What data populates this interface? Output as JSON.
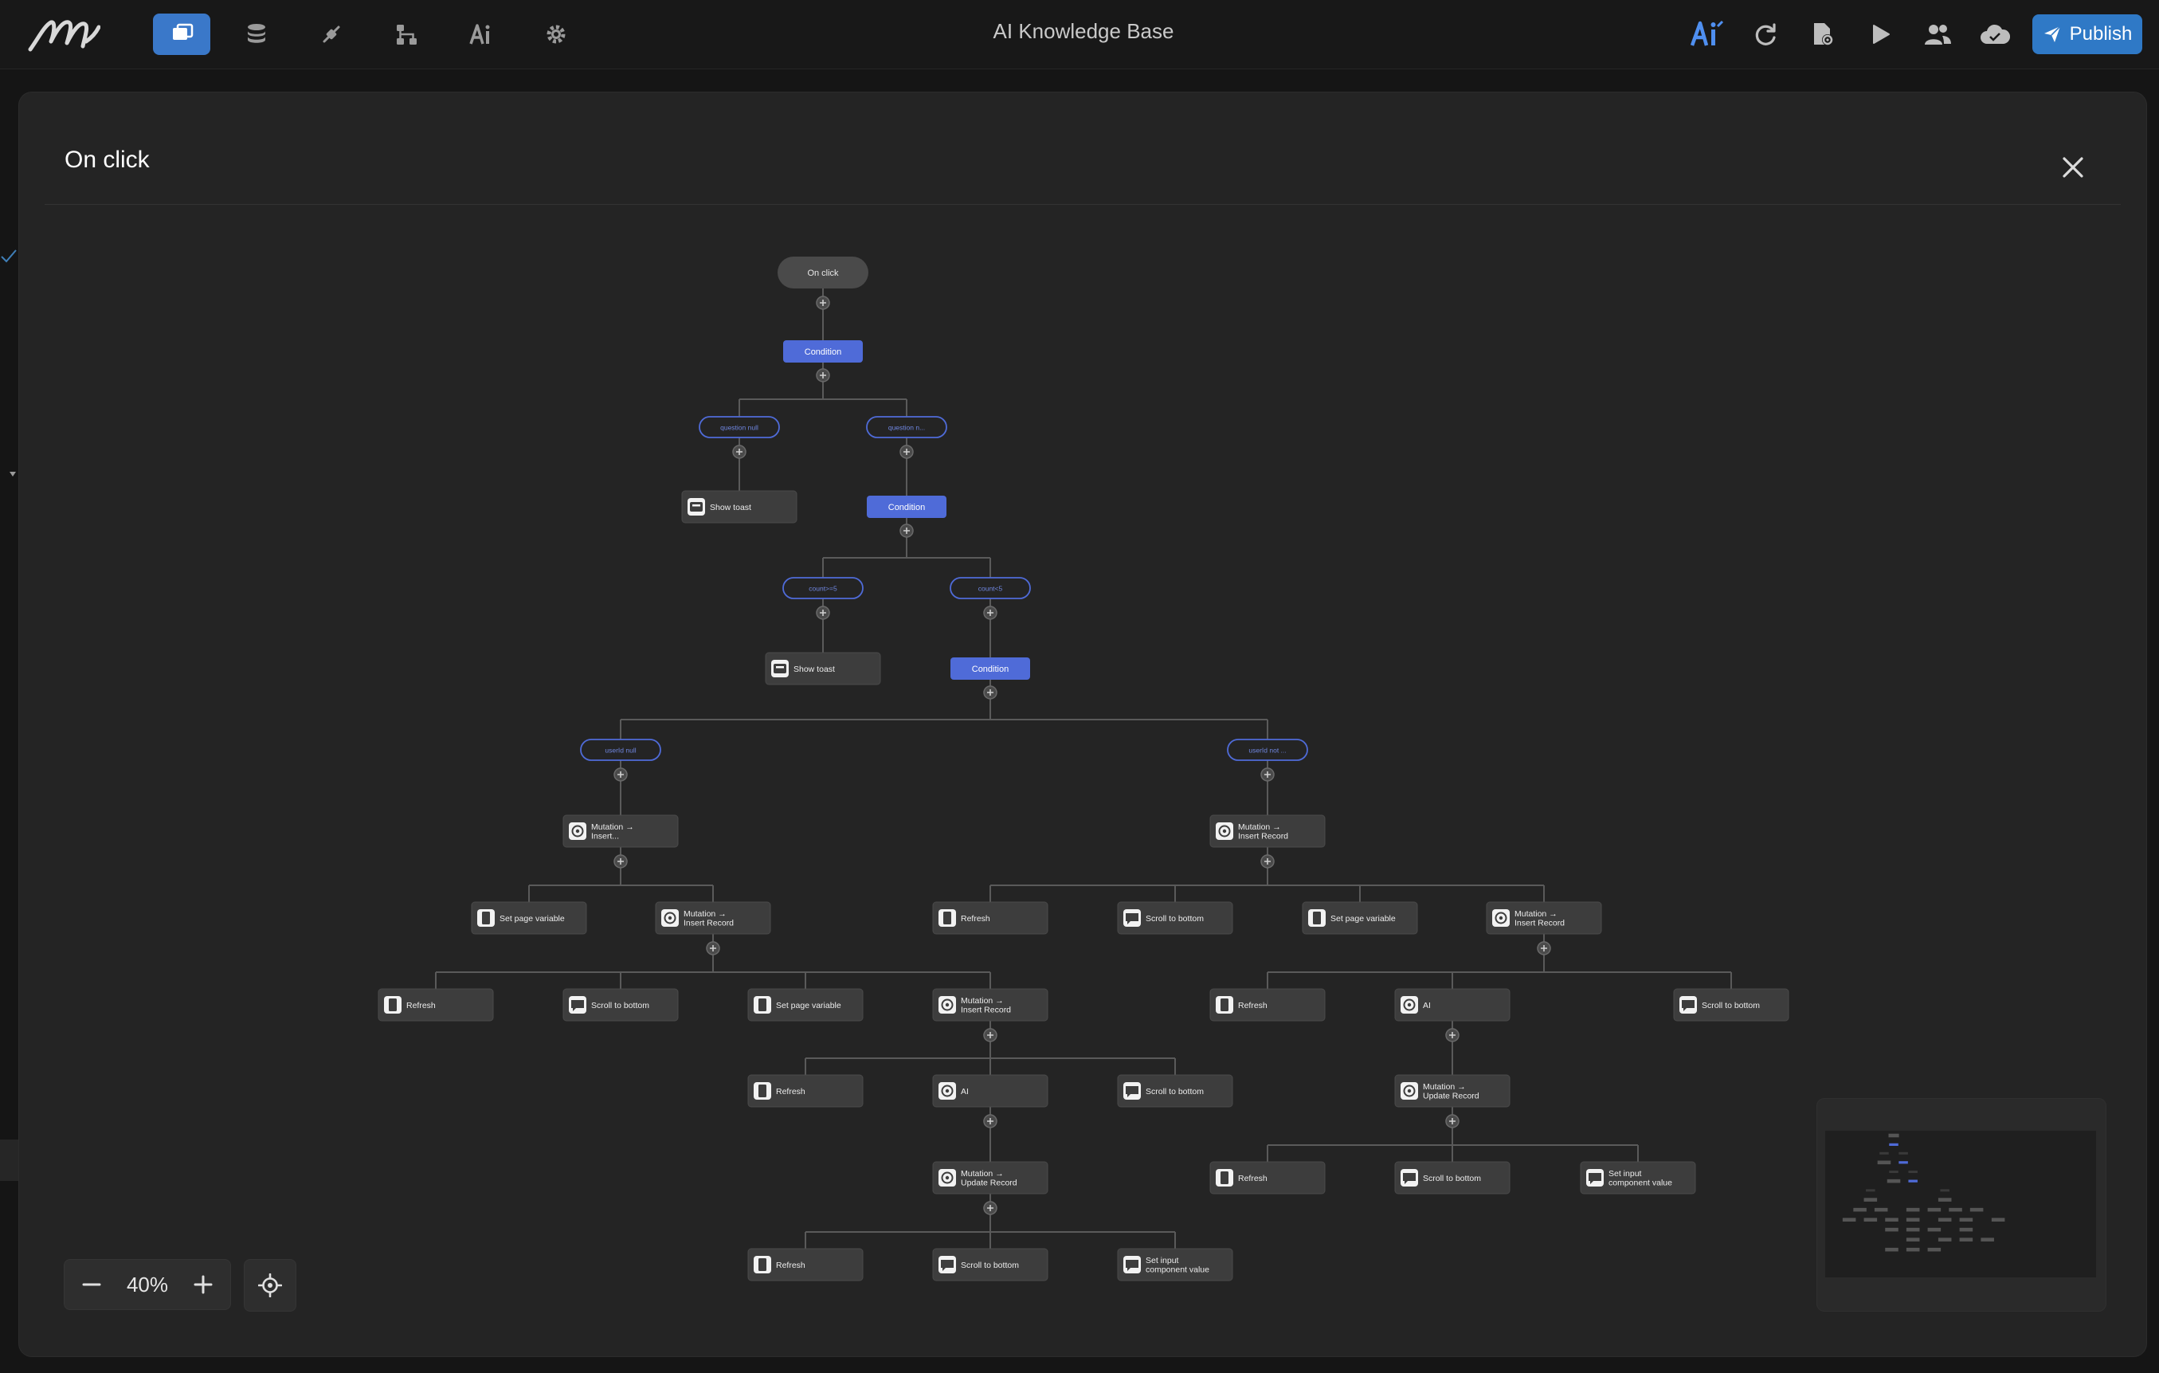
{
  "app": {
    "title": "AI Knowledge Base",
    "publish_label": "Publish"
  },
  "nav": {
    "items": [
      {
        "name": "pages-icon",
        "active": true
      },
      {
        "name": "database-icon",
        "active": false
      },
      {
        "name": "plugin-icon",
        "active": false
      },
      {
        "name": "workflow-icon",
        "active": false
      },
      {
        "name": "ai-icon",
        "active": false
      },
      {
        "name": "settings-icon",
        "active": false
      }
    ]
  },
  "toolbar": {
    "icons": [
      "ai-assistant-icon",
      "refresh-icon",
      "page-settings-icon",
      "preview-play-icon",
      "users-icon",
      "cloud-icon"
    ]
  },
  "modal": {
    "title": "On click"
  },
  "flow": {
    "nodes": [
      {
        "id": "root",
        "type": "start",
        "label": "On click"
      },
      {
        "id": "cond1",
        "type": "condition",
        "label": "Condition"
      },
      {
        "id": "br1a",
        "type": "branch",
        "label": "question null"
      },
      {
        "id": "br1b",
        "type": "branch",
        "label": "question n..."
      },
      {
        "id": "toast1",
        "type": "action",
        "label": "Show toast",
        "icon": "toast-icon"
      },
      {
        "id": "cond2",
        "type": "condition",
        "label": "Condition"
      },
      {
        "id": "br2a",
        "type": "branch",
        "label": "count>=5"
      },
      {
        "id": "br2b",
        "type": "branch",
        "label": "count<5"
      },
      {
        "id": "toast2",
        "type": "action",
        "label": "Show toast",
        "icon": "toast-icon"
      },
      {
        "id": "cond3",
        "type": "condition",
        "label": "Condition"
      },
      {
        "id": "br3a",
        "type": "branch",
        "label": "userId null"
      },
      {
        "id": "br3b",
        "type": "branch",
        "label": "userId not ..."
      },
      {
        "id": "mutL",
        "type": "action",
        "label": [
          "Mutation →",
          "Insert..."
        ],
        "icon": "mutation-icon"
      },
      {
        "id": "mutR",
        "type": "action",
        "label": [
          "Mutation →",
          "Insert Record"
        ],
        "icon": "mutation-icon"
      },
      {
        "id": "spvL1",
        "type": "action",
        "label": "Set page variable",
        "icon": "variable-icon"
      },
      {
        "id": "mutL2",
        "type": "action",
        "label": [
          "Mutation →",
          "Insert Record"
        ],
        "icon": "mutation-icon"
      },
      {
        "id": "refR1",
        "type": "action",
        "label": "Refresh",
        "icon": "refresh-action-icon"
      },
      {
        "id": "scrR1",
        "type": "action",
        "label": "Scroll to bottom",
        "icon": "scroll-icon"
      },
      {
        "id": "spvR1",
        "type": "action",
        "label": "Set page variable",
        "icon": "variable-icon"
      },
      {
        "id": "mutR2",
        "type": "action",
        "label": [
          "Mutation →",
          "Insert Record"
        ],
        "icon": "mutation-icon"
      },
      {
        "id": "refL3",
        "type": "action",
        "label": "Refresh",
        "icon": "refresh-action-icon"
      },
      {
        "id": "scrL3",
        "type": "action",
        "label": "Scroll to bottom",
        "icon": "scroll-icon"
      },
      {
        "id": "spvL3",
        "type": "action",
        "label": "Set page variable",
        "icon": "variable-icon"
      },
      {
        "id": "mutL3",
        "type": "action",
        "label": [
          "Mutation →",
          "Insert Record"
        ],
        "icon": "mutation-icon"
      },
      {
        "id": "refR3",
        "type": "action",
        "label": "Refresh",
        "icon": "refresh-action-icon"
      },
      {
        "id": "aiR3",
        "type": "action",
        "label": "AI",
        "icon": "mutation-icon"
      },
      {
        "id": "scrR3",
        "type": "action",
        "label": "Scroll to bottom",
        "icon": "scroll-icon"
      },
      {
        "id": "refL4",
        "type": "action",
        "label": "Refresh",
        "icon": "refresh-action-icon"
      },
      {
        "id": "aiL4",
        "type": "action",
        "label": "AI",
        "icon": "mutation-icon"
      },
      {
        "id": "scrL4",
        "type": "action",
        "label": "Scroll to bottom",
        "icon": "scroll-icon"
      },
      {
        "id": "updR4",
        "type": "action",
        "label": [
          "Mutation →",
          "Update Record"
        ],
        "icon": "mutation-icon"
      },
      {
        "id": "updL5",
        "type": "action",
        "label": [
          "Mutation →",
          "Update Record"
        ],
        "icon": "mutation-icon"
      },
      {
        "id": "refR5",
        "type": "action",
        "label": "Refresh",
        "icon": "refresh-action-icon"
      },
      {
        "id": "scrR5",
        "type": "action",
        "label": "Scroll to bottom",
        "icon": "scroll-icon"
      },
      {
        "id": "sicR5",
        "type": "action",
        "label": [
          "Set input",
          "component value"
        ],
        "icon": "scroll-icon"
      },
      {
        "id": "refL6",
        "type": "action",
        "label": "Refresh",
        "icon": "refresh-action-icon"
      },
      {
        "id": "scrL6",
        "type": "action",
        "label": "Scroll to bottom",
        "icon": "scroll-icon"
      },
      {
        "id": "sicL6",
        "type": "action",
        "label": [
          "Set input",
          "component value"
        ],
        "icon": "scroll-icon"
      }
    ],
    "edges": [
      [
        "root",
        "cond1"
      ],
      [
        "cond1",
        "br1a"
      ],
      [
        "cond1",
        "br1b"
      ],
      [
        "br1a",
        "toast1"
      ],
      [
        "br1b",
        "cond2"
      ],
      [
        "cond2",
        "br2a"
      ],
      [
        "cond2",
        "br2b"
      ],
      [
        "br2a",
        "toast2"
      ],
      [
        "br2b",
        "cond3"
      ],
      [
        "cond3",
        "br3a"
      ],
      [
        "cond3",
        "br3b"
      ],
      [
        "br3a",
        "mutL"
      ],
      [
        "br3b",
        "mutR"
      ],
      [
        "mutL",
        "spvL1"
      ],
      [
        "mutL",
        "mutL2"
      ],
      [
        "mutR",
        "refR1"
      ],
      [
        "mutR",
        "scrR1"
      ],
      [
        "mutR",
        "spvR1"
      ],
      [
        "mutR",
        "mutR2"
      ],
      [
        "mutL2",
        "refL3"
      ],
      [
        "mutL2",
        "scrL3"
      ],
      [
        "mutL2",
        "spvL3"
      ],
      [
        "mutL2",
        "mutL3"
      ],
      [
        "mutR2",
        "refR3"
      ],
      [
        "mutR2",
        "aiR3"
      ],
      [
        "mutR2",
        "scrR3"
      ],
      [
        "mutL3",
        "refL4"
      ],
      [
        "mutL3",
        "aiL4"
      ],
      [
        "mutL3",
        "scrL4"
      ],
      [
        "aiR3",
        "updR4"
      ],
      [
        "aiL4",
        "updL5"
      ],
      [
        "updR4",
        "refR5"
      ],
      [
        "updR4",
        "scrR5"
      ],
      [
        "updR4",
        "sicR5"
      ],
      [
        "updL5",
        "refL6"
      ],
      [
        "updL5",
        "scrL6"
      ],
      [
        "updL5",
        "sicL6"
      ]
    ]
  },
  "zoom": {
    "value": "40%"
  },
  "colors": {
    "accent": "#4f6bd8",
    "publish": "#2f79c6",
    "nav_active": "#3a78c9",
    "node": "#3d3d3d"
  }
}
